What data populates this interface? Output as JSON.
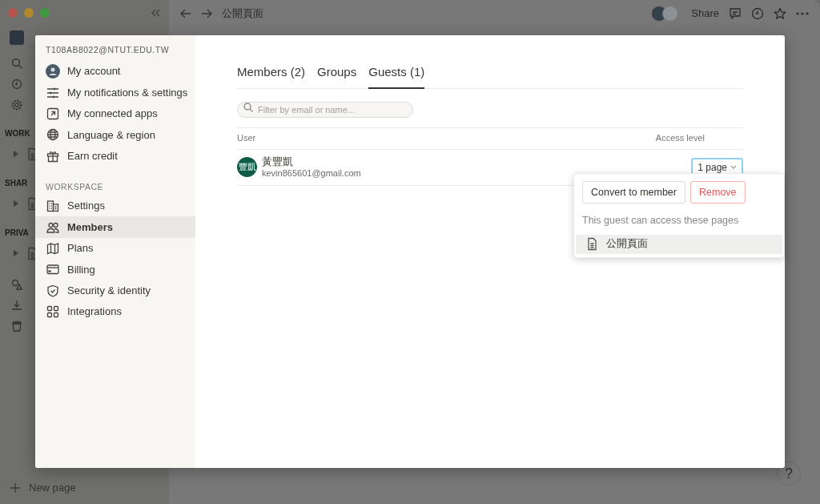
{
  "topbar": {
    "page_title": "公開頁面",
    "share": "Share"
  },
  "background_sidebar": {
    "rows": [
      {
        "kind": "item"
      },
      {
        "kind": "item"
      },
      {
        "kind": "item"
      },
      {
        "kind": "section",
        "text": "WORK"
      },
      {
        "kind": "page"
      },
      {
        "kind": "section",
        "text": "SHAR"
      },
      {
        "kind": "page"
      },
      {
        "kind": "section",
        "text": "PRIVA"
      },
      {
        "kind": "page"
      },
      {
        "kind": "item"
      },
      {
        "kind": "item"
      },
      {
        "kind": "item"
      }
    ],
    "new_page": "New page"
  },
  "settings": {
    "account_email": "T108AB8022@NTUT.EDU.TW",
    "account_items": [
      {
        "label": "My account"
      },
      {
        "label": "My notifications & settings"
      },
      {
        "label": "My connected apps"
      },
      {
        "label": "Language & region"
      },
      {
        "label": "Earn credit"
      }
    ],
    "workspace_heading": "WORKSPACE",
    "workspace_items": [
      {
        "label": "Settings",
        "selected": false
      },
      {
        "label": "Members",
        "selected": true
      },
      {
        "label": "Plans",
        "selected": false
      },
      {
        "label": "Billing",
        "selected": false
      },
      {
        "label": "Security & identity",
        "selected": false
      },
      {
        "label": "Integrations",
        "selected": false
      }
    ],
    "tabs": [
      {
        "label": "Members (2)",
        "selected": false
      },
      {
        "label": "Groups",
        "selected": false
      },
      {
        "label": "Guests (1)",
        "selected": true
      }
    ],
    "search": {
      "placeholder": "Filter by email or name..."
    },
    "table": {
      "columns": [
        "User",
        "Access level"
      ],
      "rows": [
        {
          "avatar_text": "豐凱",
          "name": "黃豐凱",
          "email": "kevin865601@gmail.com",
          "access": "1 page"
        }
      ]
    }
  },
  "guest_menu": {
    "buttons": [
      {
        "kind": "primary",
        "label": "Convert to member"
      },
      {
        "kind": "danger",
        "label": "Remove"
      }
    ],
    "note": "This guest can access these pages",
    "pages": [
      {
        "title": "公開頁面",
        "selected": true
      }
    ]
  },
  "help": "?"
}
